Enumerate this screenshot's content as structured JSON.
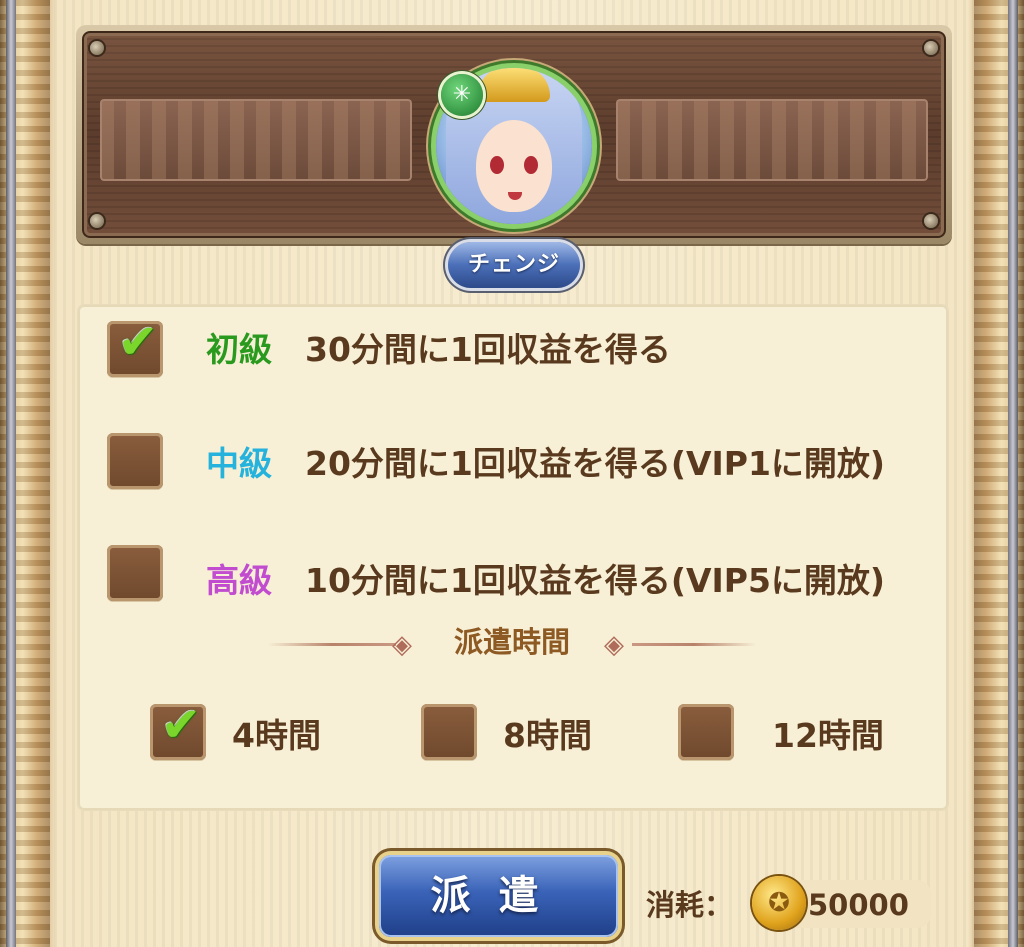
{
  "banner": {
    "element_icon": "wind-element-icon",
    "character_icon": "character-portrait"
  },
  "change_button": {
    "label": "チェンジ"
  },
  "options": [
    {
      "level": "初級",
      "level_color": "#2a9a1e",
      "description": "30分間に1回収益を得る",
      "checked": true
    },
    {
      "level": "中級",
      "level_color": "#25b2dc",
      "description": "20分間に1回収益を得る(VIP1に開放)",
      "checked": false
    },
    {
      "level": "高級",
      "level_color": "#c24ccf",
      "description": "10分間に1回収益を得る(VIP5に開放)",
      "checked": false
    }
  ],
  "duration": {
    "title": "派遣時間",
    "choices": [
      {
        "label": "4時間",
        "checked": true
      },
      {
        "label": "8時間",
        "checked": false
      },
      {
        "label": "12時間",
        "checked": false
      }
    ]
  },
  "dispatch_button": {
    "label": "派遣"
  },
  "cost": {
    "label": "消耗：",
    "currency_icon": "gold-coin-icon",
    "value": "50000"
  },
  "colors": {
    "panel_bg": "#f7efd6",
    "text_brown": "#5a3a1e",
    "check_green": "#7ad62b",
    "button_blue": "#3a63b8"
  }
}
